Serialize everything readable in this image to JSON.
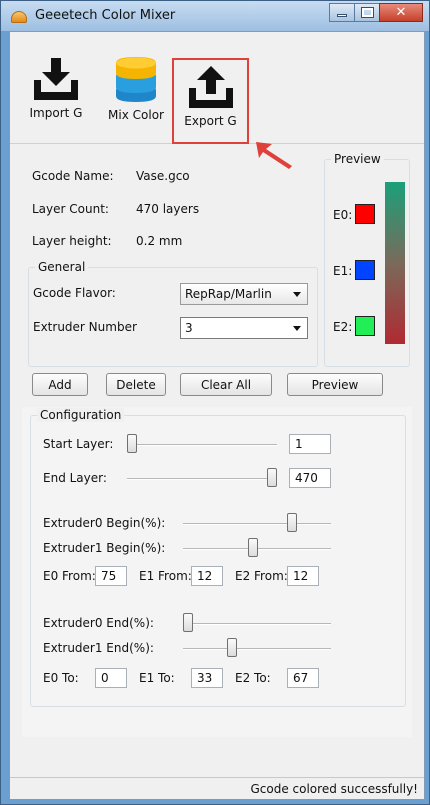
{
  "window": {
    "title": "Geeetech Color Mixer"
  },
  "toolbar": {
    "import_label": "Import G",
    "mix_label": "Mix Color",
    "export_label": "Export G"
  },
  "info": {
    "gcode_name_label": "Gcode Name:",
    "gcode_name_value": "Vase.gco",
    "layer_count_label": "Layer Count:",
    "layer_count_value": "470 layers",
    "layer_height_label": "Layer height:",
    "layer_height_value": "0.2 mm"
  },
  "general": {
    "title": "General",
    "flavor_label": "Gcode Flavor:",
    "flavor_value": "RepRap/Marlin",
    "extruder_label": "Extruder Number",
    "extruder_value": "3"
  },
  "preview": {
    "title": "Preview",
    "e0_label": "E0:",
    "e1_label": "E1:",
    "e2_label": "E2:",
    "colors": {
      "e0": "#ff0000",
      "e1": "#0044ff",
      "e2": "#22ee55"
    }
  },
  "actions": {
    "add": "Add",
    "delete": "Delete",
    "clear_all": "Clear All",
    "preview": "Preview"
  },
  "config": {
    "title": "Configuration",
    "start_layer_label": "Start Layer:",
    "start_layer_value": "1",
    "end_layer_label": "End Layer:",
    "end_layer_value": "470",
    "ext0_begin_label": "Extruder0 Begin(%):",
    "ext1_begin_label": "Extruder1 Begin(%):",
    "e0_from_label": "E0 From:",
    "e0_from_value": "75",
    "e1_from_label": "E1 From:",
    "e1_from_value": "12",
    "e2_from_label": "E2 From:",
    "e2_from_value": "12",
    "ext0_end_label": "Extruder0 End(%):",
    "ext1_end_label": "Extruder1 End(%):",
    "e0_to_label": "E0 To:",
    "e0_to_value": "0",
    "e1_to_label": "E1 To:",
    "e1_to_value": "33",
    "e2_to_label": "E2 To:",
    "e2_to_value": "67"
  },
  "status": {
    "message": "Gcode colored successfully!"
  }
}
